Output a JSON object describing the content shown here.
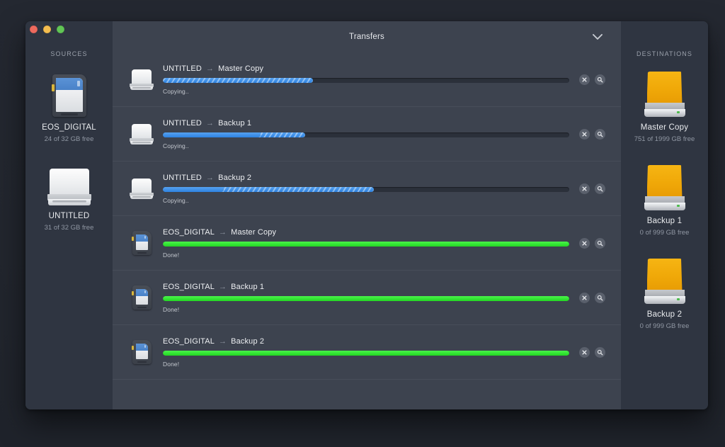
{
  "window": {
    "traffic_lights": [
      {
        "name": "close",
        "color": "#ed6a5e"
      },
      {
        "name": "minimize",
        "color": "#f4bd4f"
      },
      {
        "name": "zoom",
        "color": "#61c555"
      }
    ]
  },
  "sidebar": {
    "heading": "SOURCES",
    "devices": [
      {
        "icon": "sd-card-icon",
        "name": "EOS_DIGITAL",
        "free": "24 of 32 GB free"
      },
      {
        "icon": "hard-drive-icon",
        "name": "UNTITLED",
        "free": "31 of 32 GB free"
      }
    ]
  },
  "main": {
    "title": "Transfers",
    "collapse_icon": "chevron-down-icon",
    "cancel_icon": "close-icon",
    "reveal_icon": "magnifier-icon",
    "arrow": "→",
    "transfers": [
      {
        "icon": "hard-drive-icon",
        "source": "UNTITLED",
        "destination": "Master Copy",
        "status": "Copying..",
        "state": "copying",
        "solid_percent": 0,
        "stripe_percent": 37
      },
      {
        "icon": "hard-drive-icon",
        "source": "UNTITLED",
        "destination": "Backup 1",
        "status": "Copying..",
        "state": "copying",
        "solid_percent": 24,
        "stripe_percent": 35
      },
      {
        "icon": "hard-drive-icon",
        "source": "UNTITLED",
        "destination": "Backup 2",
        "status": "Copying..",
        "state": "copying",
        "solid_percent": 15,
        "stripe_percent": 52
      },
      {
        "icon": "sd-card-icon",
        "source": "EOS_DIGITAL",
        "destination": "Master Copy",
        "status": "Done!",
        "state": "done",
        "solid_percent": 100,
        "stripe_percent": 100
      },
      {
        "icon": "sd-card-icon",
        "source": "EOS_DIGITAL",
        "destination": "Backup 1",
        "status": "Done!",
        "state": "done",
        "solid_percent": 100,
        "stripe_percent": 100
      },
      {
        "icon": "sd-card-icon",
        "source": "EOS_DIGITAL",
        "destination": "Backup 2",
        "status": "Done!",
        "state": "done",
        "solid_percent": 100,
        "stripe_percent": 100
      }
    ]
  },
  "destinations": {
    "heading": "DESTINATIONS",
    "devices": [
      {
        "icon": "external-drive-icon",
        "name": "Master Copy",
        "free": "751 of 1999 GB free"
      },
      {
        "icon": "external-drive-icon",
        "name": "Backup 1",
        "free": "0 of 999 GB free"
      },
      {
        "icon": "external-drive-icon",
        "name": "Backup 2",
        "free": "0 of 999 GB free"
      }
    ]
  },
  "colors": {
    "app_background": "#22262e",
    "sidebar": "#2f3541",
    "center_panel": "#3d434f",
    "progress_track": "#2b303a",
    "progress_blue": "#2e82e0",
    "progress_green": "#23d723",
    "drive_orange": "#f0a808"
  }
}
